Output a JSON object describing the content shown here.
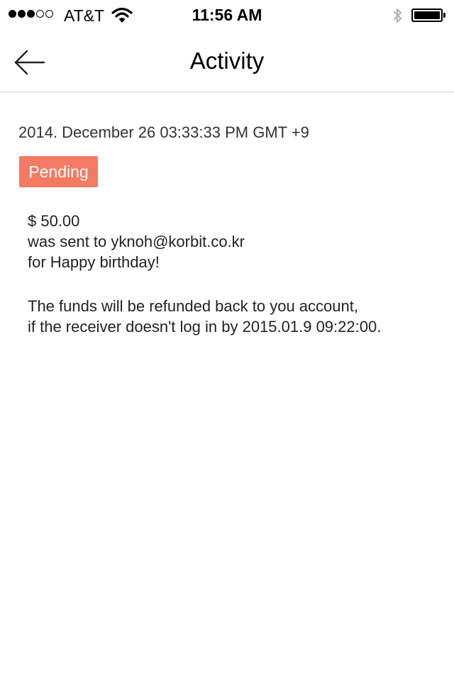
{
  "status_bar": {
    "signal_dots_filled": 3,
    "signal_dots_total": 5,
    "carrier": "AT&T",
    "wifi_icon": "wifi-icon",
    "time": "11:56 AM",
    "bluetooth_icon": "bluetooth-icon",
    "battery_icon": "battery-icon",
    "battery_level": 1.0
  },
  "nav": {
    "back_icon": "arrow-left-icon",
    "title": "Activity"
  },
  "activity": {
    "timestamp": "2014. December 26 03:33:33 PM GMT +9",
    "status": "Pending",
    "status_color": "#f47a63",
    "amount_line": "$ 50.00",
    "recipient_line": "was sent to yknoh@korbit.co.kr",
    "memo_line": "for Happy birthday!",
    "refund_line_1": "The funds will be refunded back to you account,",
    "refund_line_2": "if the receiver doesn't log in by 2015.01.9 09:22:00."
  }
}
